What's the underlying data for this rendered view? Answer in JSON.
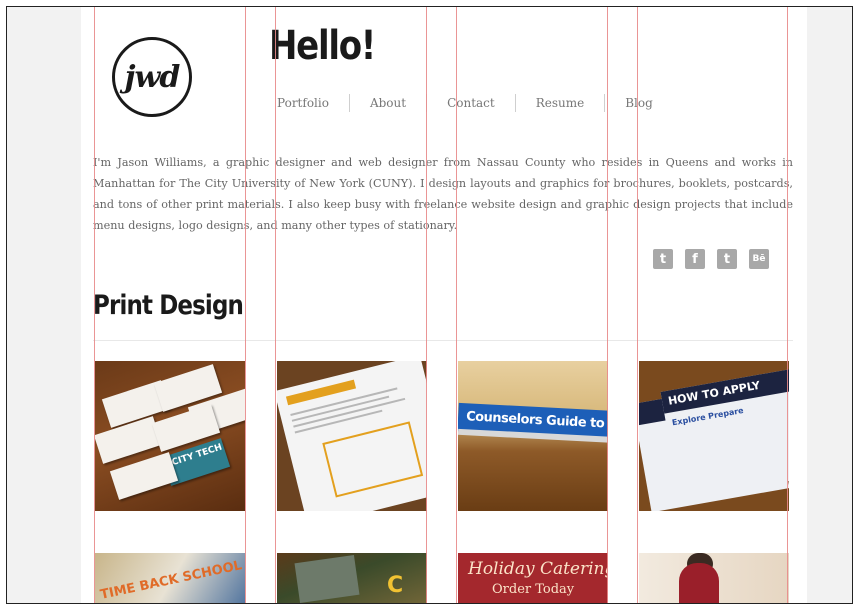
{
  "logo": {
    "text": "jwd"
  },
  "header": {
    "title": "Hello!"
  },
  "nav": {
    "items": [
      "Portfolio",
      "About",
      "Contact",
      "Resume",
      "Blog"
    ]
  },
  "intro": {
    "text": "I'm Jason Williams, a graphic designer and web designer from Nassau County who resides in Queens and works in Manhattan for The City University of New York (CUNY). I design layouts and graphics for brochures, booklets, postcards, and tons of other print materials. I also keep busy with freelance website design and graphic design projects that include menu designs, logo designs, and many other types of stationary."
  },
  "social": {
    "tumblr": "t",
    "facebook": "f",
    "twitter": "t",
    "behance": "Bē"
  },
  "section": {
    "title": "Print Design"
  },
  "thumbs": {
    "t1": "CITY TECH",
    "t3": "Counselors Guide to Admis",
    "t4_header": "HOW TO APPLY",
    "t4_tags": "Explore   Prepare",
    "t5": "TIME BACK SCHOOL",
    "t6": "C",
    "t7_line1": "Holiday Catering",
    "t7_line2": "Order Today"
  }
}
